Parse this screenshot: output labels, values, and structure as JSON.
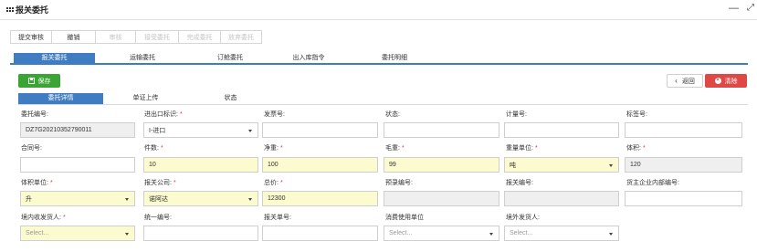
{
  "window": {
    "title": "报关委托"
  },
  "toolbar": {
    "buttons": [
      {
        "label": "提交审核",
        "state": "enabled"
      },
      {
        "label": "撤销",
        "state": "enabled"
      },
      {
        "label": "审核",
        "state": "disabled"
      },
      {
        "label": "接受委托",
        "state": "disabled"
      },
      {
        "label": "完成委托",
        "state": "disabled"
      },
      {
        "label": "放弃委托",
        "state": "disabled"
      }
    ]
  },
  "main_tabs": [
    {
      "label": "报关委托",
      "active": true
    },
    {
      "label": "运输委托",
      "active": false
    },
    {
      "label": "订舱委托",
      "active": false
    },
    {
      "label": "出入库指令",
      "active": false
    },
    {
      "label": "委托明细",
      "active": false
    }
  ],
  "actions": {
    "save": "保存",
    "back": "返回",
    "clear": "清除"
  },
  "sub_tabs": [
    {
      "label": "委托详情",
      "active": true
    },
    {
      "label": "单证上传",
      "active": false
    },
    {
      "label": "状态",
      "active": false
    }
  ],
  "form": {
    "row1": [
      {
        "label": "委托编号:",
        "required": false,
        "value": "DZ7G20210352790011",
        "style": "gray"
      },
      {
        "label": "进出口标识:",
        "required": true,
        "value": "I-进口",
        "style": "white",
        "select": true
      },
      {
        "label": "发票号:",
        "required": false,
        "value": "",
        "style": "white"
      },
      {
        "label": "状态:",
        "required": false,
        "value": "",
        "style": "white"
      },
      {
        "label": "计量号:",
        "required": false,
        "value": "",
        "style": "white"
      },
      {
        "label": "标签号:",
        "required": false,
        "value": "",
        "style": "white"
      }
    ],
    "row2": [
      {
        "label": "合同号:",
        "required": false,
        "value": "",
        "style": "white"
      },
      {
        "label": "件数:",
        "required": true,
        "value": "10",
        "style": "yellow"
      },
      {
        "label": "净重:",
        "required": true,
        "value": "100",
        "style": "yellow"
      },
      {
        "label": "毛重:",
        "required": true,
        "value": "99",
        "style": "yellow"
      },
      {
        "label": "重量单位:",
        "required": true,
        "value": "吨",
        "style": "yellow",
        "select": true
      },
      {
        "label": "体积:",
        "required": true,
        "value": "120",
        "style": "gray"
      }
    ],
    "row3": [
      {
        "label": "体积单位:",
        "required": true,
        "value": "升",
        "style": "yellow",
        "select": true
      },
      {
        "label": "报关公司:",
        "required": true,
        "value": "诺阿达",
        "style": "yellow",
        "select": true
      },
      {
        "label": "总价:",
        "required": true,
        "value": "12300",
        "style": "yellow"
      },
      {
        "label": "预录编号:",
        "required": false,
        "value": "",
        "style": "gray"
      },
      {
        "label": "报关编号:",
        "required": false,
        "value": "",
        "style": "gray"
      },
      {
        "label": "货主企业内部编号:",
        "required": false,
        "value": "",
        "style": "white"
      }
    ],
    "row4": [
      {
        "label": "境内收发货人:",
        "required": true,
        "value": "Select...",
        "style": "yellow",
        "select": true,
        "placeholder": true
      },
      {
        "label": "统一编号:",
        "required": false,
        "value": "",
        "style": "white"
      },
      {
        "label": "报关单号:",
        "required": false,
        "value": "",
        "style": "white"
      },
      {
        "label": "消费使用单位",
        "required": false,
        "value": "Select...",
        "style": "white",
        "select": true,
        "placeholder": true
      },
      {
        "label": "境外发货人:",
        "required": false,
        "value": "Select...",
        "style": "white",
        "select": true,
        "placeholder": true
      }
    ]
  }
}
